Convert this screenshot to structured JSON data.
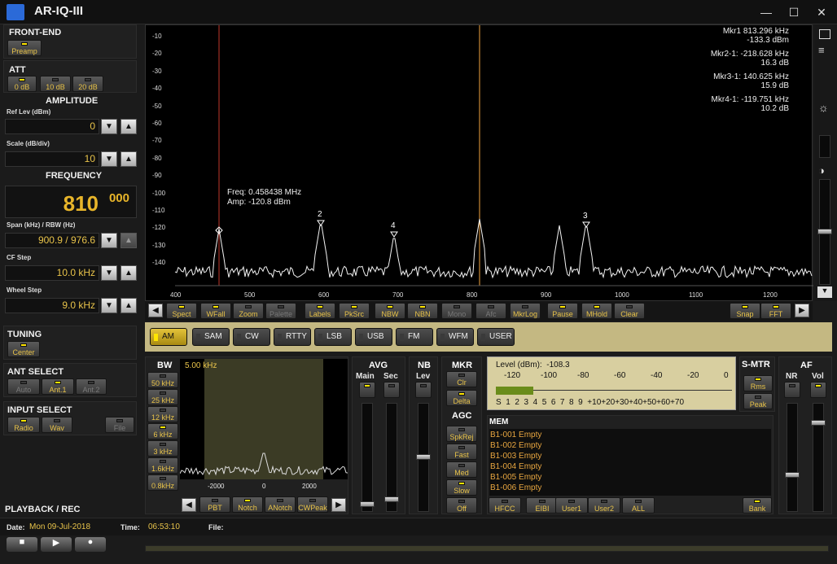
{
  "app": {
    "title": "AR-IQ-III"
  },
  "window": {
    "minimize": "—",
    "maximize": "☐",
    "close": "✕"
  },
  "frontend": {
    "title": "FRONT-END",
    "preamp": "Preamp"
  },
  "att": {
    "title": "ATT",
    "buttons": [
      "0 dB",
      "10 dB",
      "20 dB"
    ]
  },
  "amplitude": {
    "title": "AMPLITUDE",
    "ref_label": "Ref Lev (dBm)",
    "ref_value": "0",
    "scale_label": "Scale (dB/div)",
    "scale_value": "10"
  },
  "frequency": {
    "title": "FREQUENCY",
    "value": "810",
    "value_small": "000",
    "span_label": "Span (kHz) / RBW (Hz)",
    "span_value": "900.9 / 976.6",
    "cf_label": "CF Step",
    "cf_value": "10.0 kHz",
    "wheel_label": "Wheel Step",
    "wheel_value": "9.0 kHz"
  },
  "tuning": {
    "title": "TUNING",
    "center": "Center"
  },
  "ant": {
    "title": "ANT SELECT",
    "buttons": [
      "Auto",
      "Ant.1",
      "Ant.2"
    ]
  },
  "input": {
    "title": "INPUT SELECT",
    "buttons": [
      "Radio",
      "Wav",
      "File"
    ]
  },
  "playback": {
    "title": "PLAYBACK / REC",
    "date_label": "Date:",
    "date_value": "Mon 09-Jul-2018",
    "time_label": "Time:",
    "time_value": "06:53:10",
    "file_label": "File:"
  },
  "spectrum": {
    "yticks": [
      "-10",
      "-20",
      "-30",
      "-40",
      "-50",
      "-60",
      "-70",
      "-80",
      "-90",
      "-100",
      "-110",
      "-120",
      "-130",
      "-140"
    ],
    "xticks": [
      "400",
      "500",
      "600",
      "700",
      "800",
      "900",
      "1000",
      "1100",
      "1200"
    ],
    "cursor_freq_label": "Freq:",
    "cursor_freq": "0.458438",
    "cursor_freq_unit": "MHz",
    "cursor_amp_label": "Amp:",
    "cursor_amp": "-120.8",
    "cursor_amp_unit": "dBm",
    "markers": [
      {
        "name": "Mkr1",
        "v1": "813.296",
        "u1": "kHz",
        "v2": "-133.3",
        "u2": "dBm"
      },
      {
        "name": "Mkr2-1:",
        "v1": "-218.628",
        "u1": "kHz",
        "v2": "16.3",
        "u2": "dB"
      },
      {
        "name": "Mkr3-1:",
        "v1": "140.625",
        "u1": "kHz",
        "v2": "15.9",
        "u2": "dB"
      },
      {
        "name": "Mkr4-1:",
        "v1": "-119.751",
        "u1": "kHz",
        "v2": "10.2",
        "u2": "dB"
      }
    ],
    "marker_tags": [
      "2",
      "4",
      "3"
    ]
  },
  "toolbar": [
    "Spect",
    "WFall",
    "Zoom",
    "Palette",
    "Labels",
    "PkSrc",
    "NBW",
    "NBN",
    "Mono",
    "Afc",
    "MkrLog",
    "Pause",
    "MHold",
    "Clear",
    "Snap",
    "FFT"
  ],
  "modes": [
    "AM",
    "SAM",
    "CW",
    "RTTY",
    "LSB",
    "USB",
    "FM",
    "WFM",
    "USER"
  ],
  "bw": {
    "title": "BW",
    "value": "5.00 kHz",
    "buttons": [
      "50 kHz",
      "25 kHz",
      "12 kHz",
      "6 kHz",
      "3 kHz",
      "1.6kHz",
      "0.8kHz"
    ],
    "xticks": [
      "-2000",
      "0",
      "2000"
    ],
    "bottom": [
      "PBT",
      "Notch",
      "ANotch",
      "CWPeak"
    ]
  },
  "avg": {
    "title": "AVG",
    "main": "Main",
    "sec": "Sec"
  },
  "nb": {
    "title": "NB",
    "lev": "Lev"
  },
  "mkr": {
    "title": "MKR",
    "clr": "Clr",
    "delta": "Delta"
  },
  "agc": {
    "title": "AGC",
    "buttons": [
      "SpkRej",
      "Fast",
      "Med",
      "Slow",
      "Off"
    ]
  },
  "meter": {
    "level_label": "Level (dBm):",
    "level_value": "-108.3",
    "top_scale": [
      "-120",
      "-100",
      "-80",
      "-60",
      "-40",
      "-20",
      "0"
    ],
    "bottom_scale": "S  1  2  3  4  5  6  7  8  9  +10+20+30+40+50+60+70",
    "level_fraction": 0.16
  },
  "smtr": {
    "title": "S-MTR",
    "rms": "Rms",
    "peak": "Peak"
  },
  "af": {
    "title": "AF",
    "nr": "NR",
    "vol": "Vol"
  },
  "mem": {
    "title": "MEM",
    "rows": [
      "B1-001 Empty",
      "B1-002 Empty",
      "B1-003 Empty",
      "B1-004 Empty",
      "B1-005 Empty",
      "B1-006 Empty"
    ],
    "buttons": [
      "HFCC",
      "EIBI",
      "User1",
      "User2",
      "ALL",
      "Bank"
    ]
  }
}
